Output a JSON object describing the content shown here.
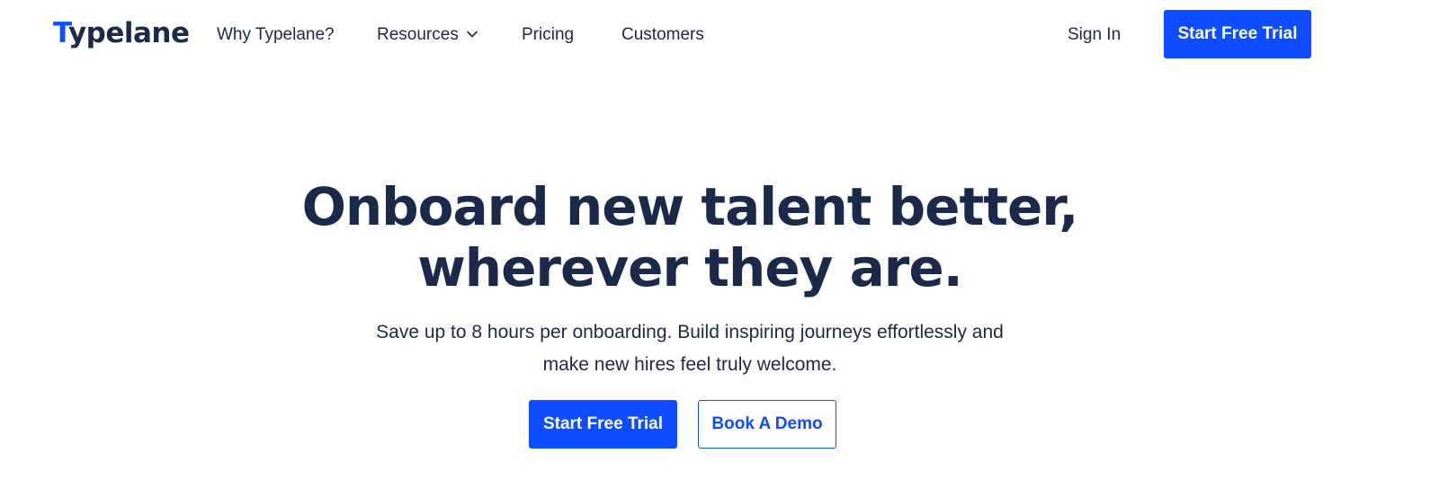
{
  "brand": {
    "logo_first_letter": "T",
    "logo_rest": "ypelane",
    "primary_color": "#0d4dff",
    "text_color": "#1b2a4a",
    "highlight_color": "#f2c96d"
  },
  "nav": {
    "items": [
      {
        "label": "Why Typelane?"
      },
      {
        "label": "Resources",
        "icon": "chevron-down-icon"
      },
      {
        "label": "Pricing"
      },
      {
        "label": "Customers"
      }
    ],
    "sign_in": "Sign In",
    "cta": "Start Free Trial"
  },
  "hero": {
    "title_line1": "Onboard new talent better,",
    "title_line2": "wherever they are.",
    "subtitle_line1": "Save up to 8 hours per onboarding. Build inspiring journeys effortlessly and",
    "subtitle_line2": "make new hires feel truly welcome.",
    "primary_cta": "Start Free Trial",
    "secondary_cta": "Book A Demo"
  }
}
